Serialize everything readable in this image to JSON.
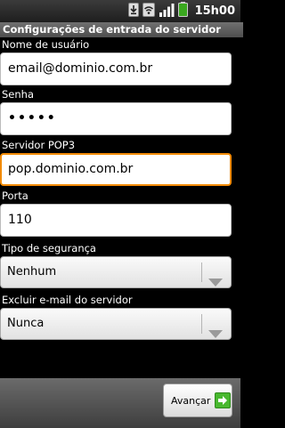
{
  "status_bar": {
    "time": "15h00",
    "icons": [
      "download-icon",
      "wifi-icon",
      "signal-icon",
      "battery-icon"
    ]
  },
  "header": {
    "title": "Configurações de entrada do servidor"
  },
  "form": {
    "username": {
      "label": "Nome de usuário",
      "value": "email@dominio.com.br"
    },
    "password": {
      "label": "Senha",
      "value": "•••••"
    },
    "server": {
      "label": "Servidor POP3",
      "value": "pop.dominio.com.br"
    },
    "port": {
      "label": "Porta",
      "value": "110"
    },
    "security": {
      "label": "Tipo de segurança",
      "selected": "Nenhum"
    },
    "delete_email": {
      "label": "Excluir e-mail do servidor",
      "selected": "Nunca"
    }
  },
  "footer": {
    "next_label": "Avançar"
  },
  "colors": {
    "focus": "#f28a00",
    "next_icon": "#48b82e"
  }
}
